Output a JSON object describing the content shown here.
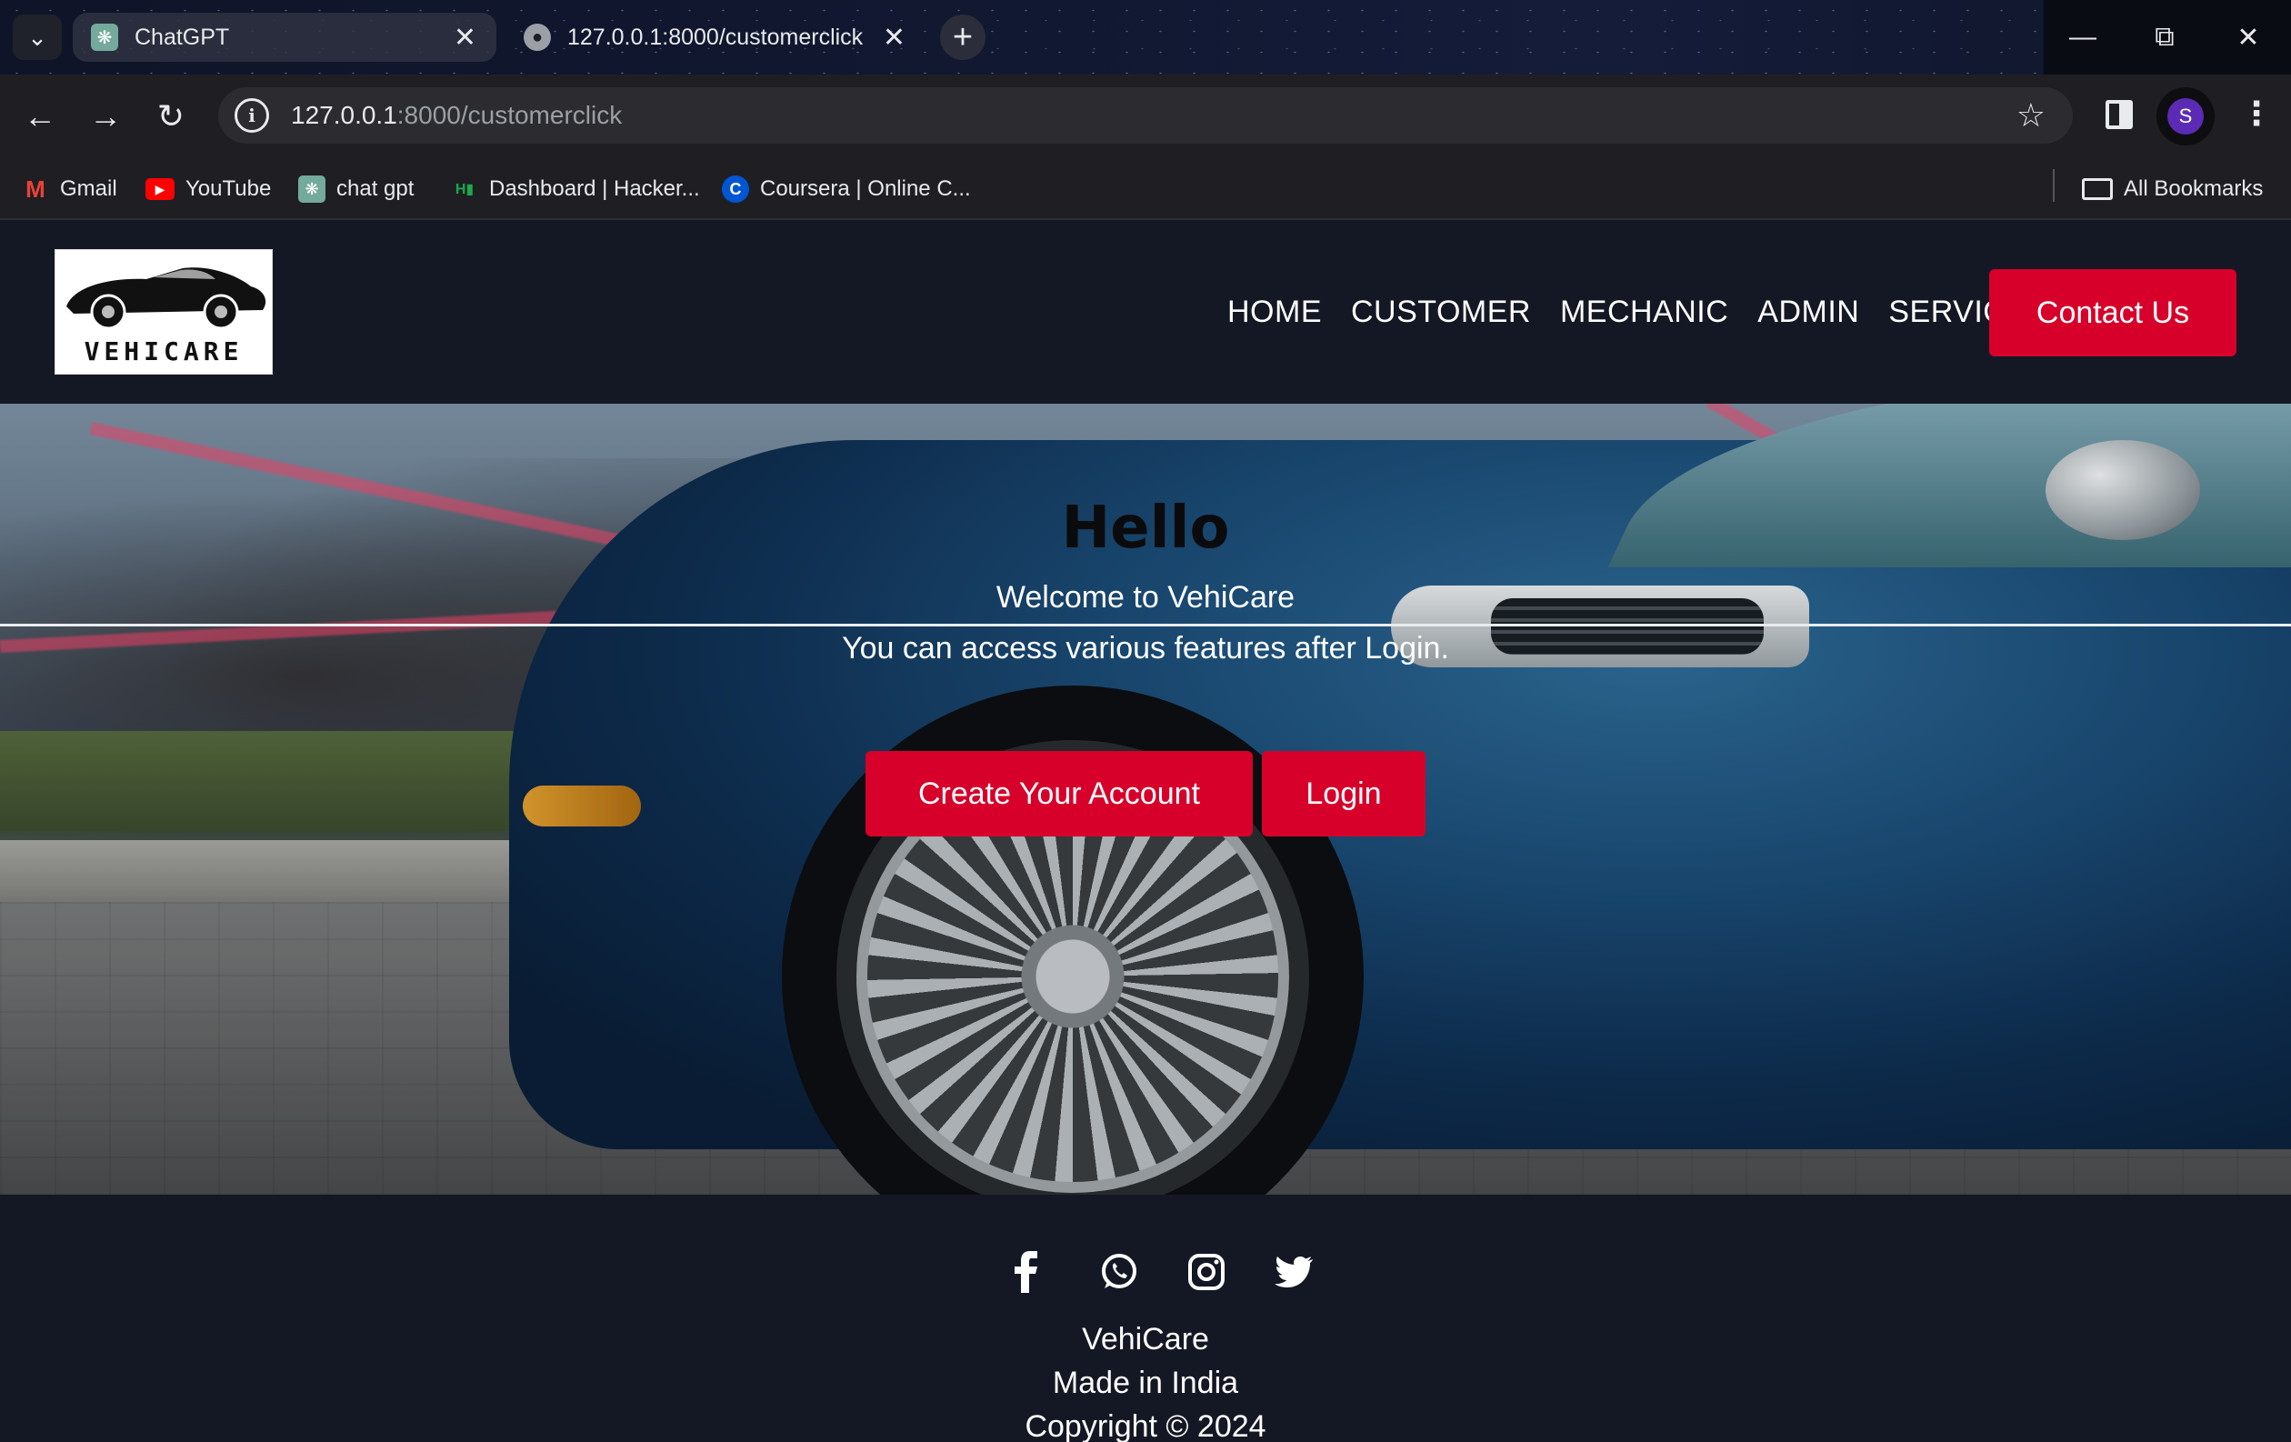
{
  "browser": {
    "tabs": [
      {
        "title": "ChatGPT",
        "favicon": "chatgpt-icon",
        "active": false
      },
      {
        "title": "127.0.0.1:8000/customerclick",
        "favicon": "globe-icon",
        "active": true
      }
    ],
    "address": {
      "host": "127.0.0.1",
      "rest": ":8000/customerclick"
    },
    "profile_initial": "S",
    "bookmarks": [
      {
        "label": "Gmail",
        "icon": "gmail-icon"
      },
      {
        "label": "YouTube",
        "icon": "youtube-icon"
      },
      {
        "label": "chat gpt",
        "icon": "chatgpt-icon"
      },
      {
        "label": "Dashboard | Hacker...",
        "icon": "hackerrank-icon"
      },
      {
        "label": "Coursera | Online C...",
        "icon": "coursera-icon"
      }
    ],
    "all_bookmarks": "All Bookmarks"
  },
  "site": {
    "logo_text": "VEHICARE",
    "nav": [
      "HOME",
      "CUSTOMER",
      "MECHANIC",
      "ADMIN",
      "SERVICES"
    ],
    "contact_label": "Contact Us",
    "hero": {
      "title": "Hello",
      "subtitle": "Welcome to VehiCare",
      "message": "You can access various features after Login.",
      "create_label": "Create Your Account",
      "login_label": "Login"
    },
    "social": [
      "facebook-icon",
      "whatsapp-icon",
      "instagram-icon",
      "twitter-icon"
    ],
    "footer": {
      "brand": "VehiCare",
      "made": "Made in India",
      "copyright": "Copyright © 2024"
    }
  },
  "colors": {
    "accent": "#d6002a",
    "page_bg": "#141824",
    "chrome_bg": "#1f1f23"
  }
}
